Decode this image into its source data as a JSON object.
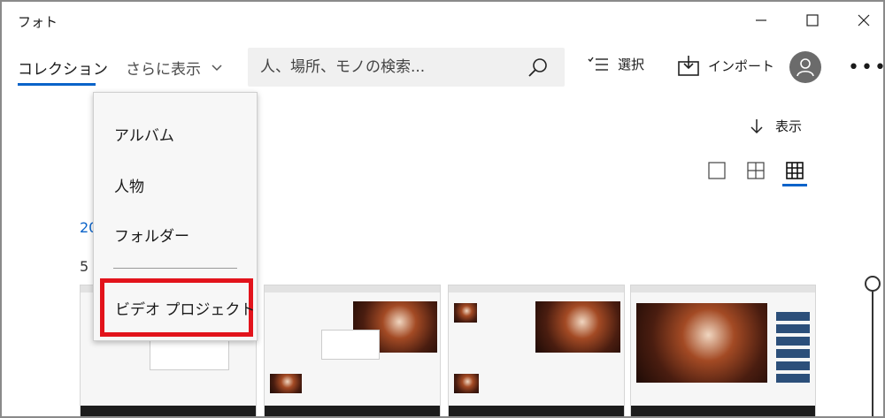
{
  "window": {
    "title": "フォト"
  },
  "toolbar": {
    "collection_label": "コレクション",
    "more_label": "さらに表示",
    "search_placeholder": "人、場所、モノの検索...",
    "select_label": "選択",
    "import_label": "インポート",
    "more_icon": "ellipsis-icon"
  },
  "view": {
    "toggle_label": "表示"
  },
  "content": {
    "date_label_partial": "20",
    "count_label_partial": "5"
  },
  "dropdown": {
    "items": [
      "アルバム",
      "人物",
      "フォルダー"
    ],
    "highlighted_item": "ビデオ プロジェクト"
  },
  "colors": {
    "accent": "#0a63c9",
    "highlight": "#e2131b"
  }
}
